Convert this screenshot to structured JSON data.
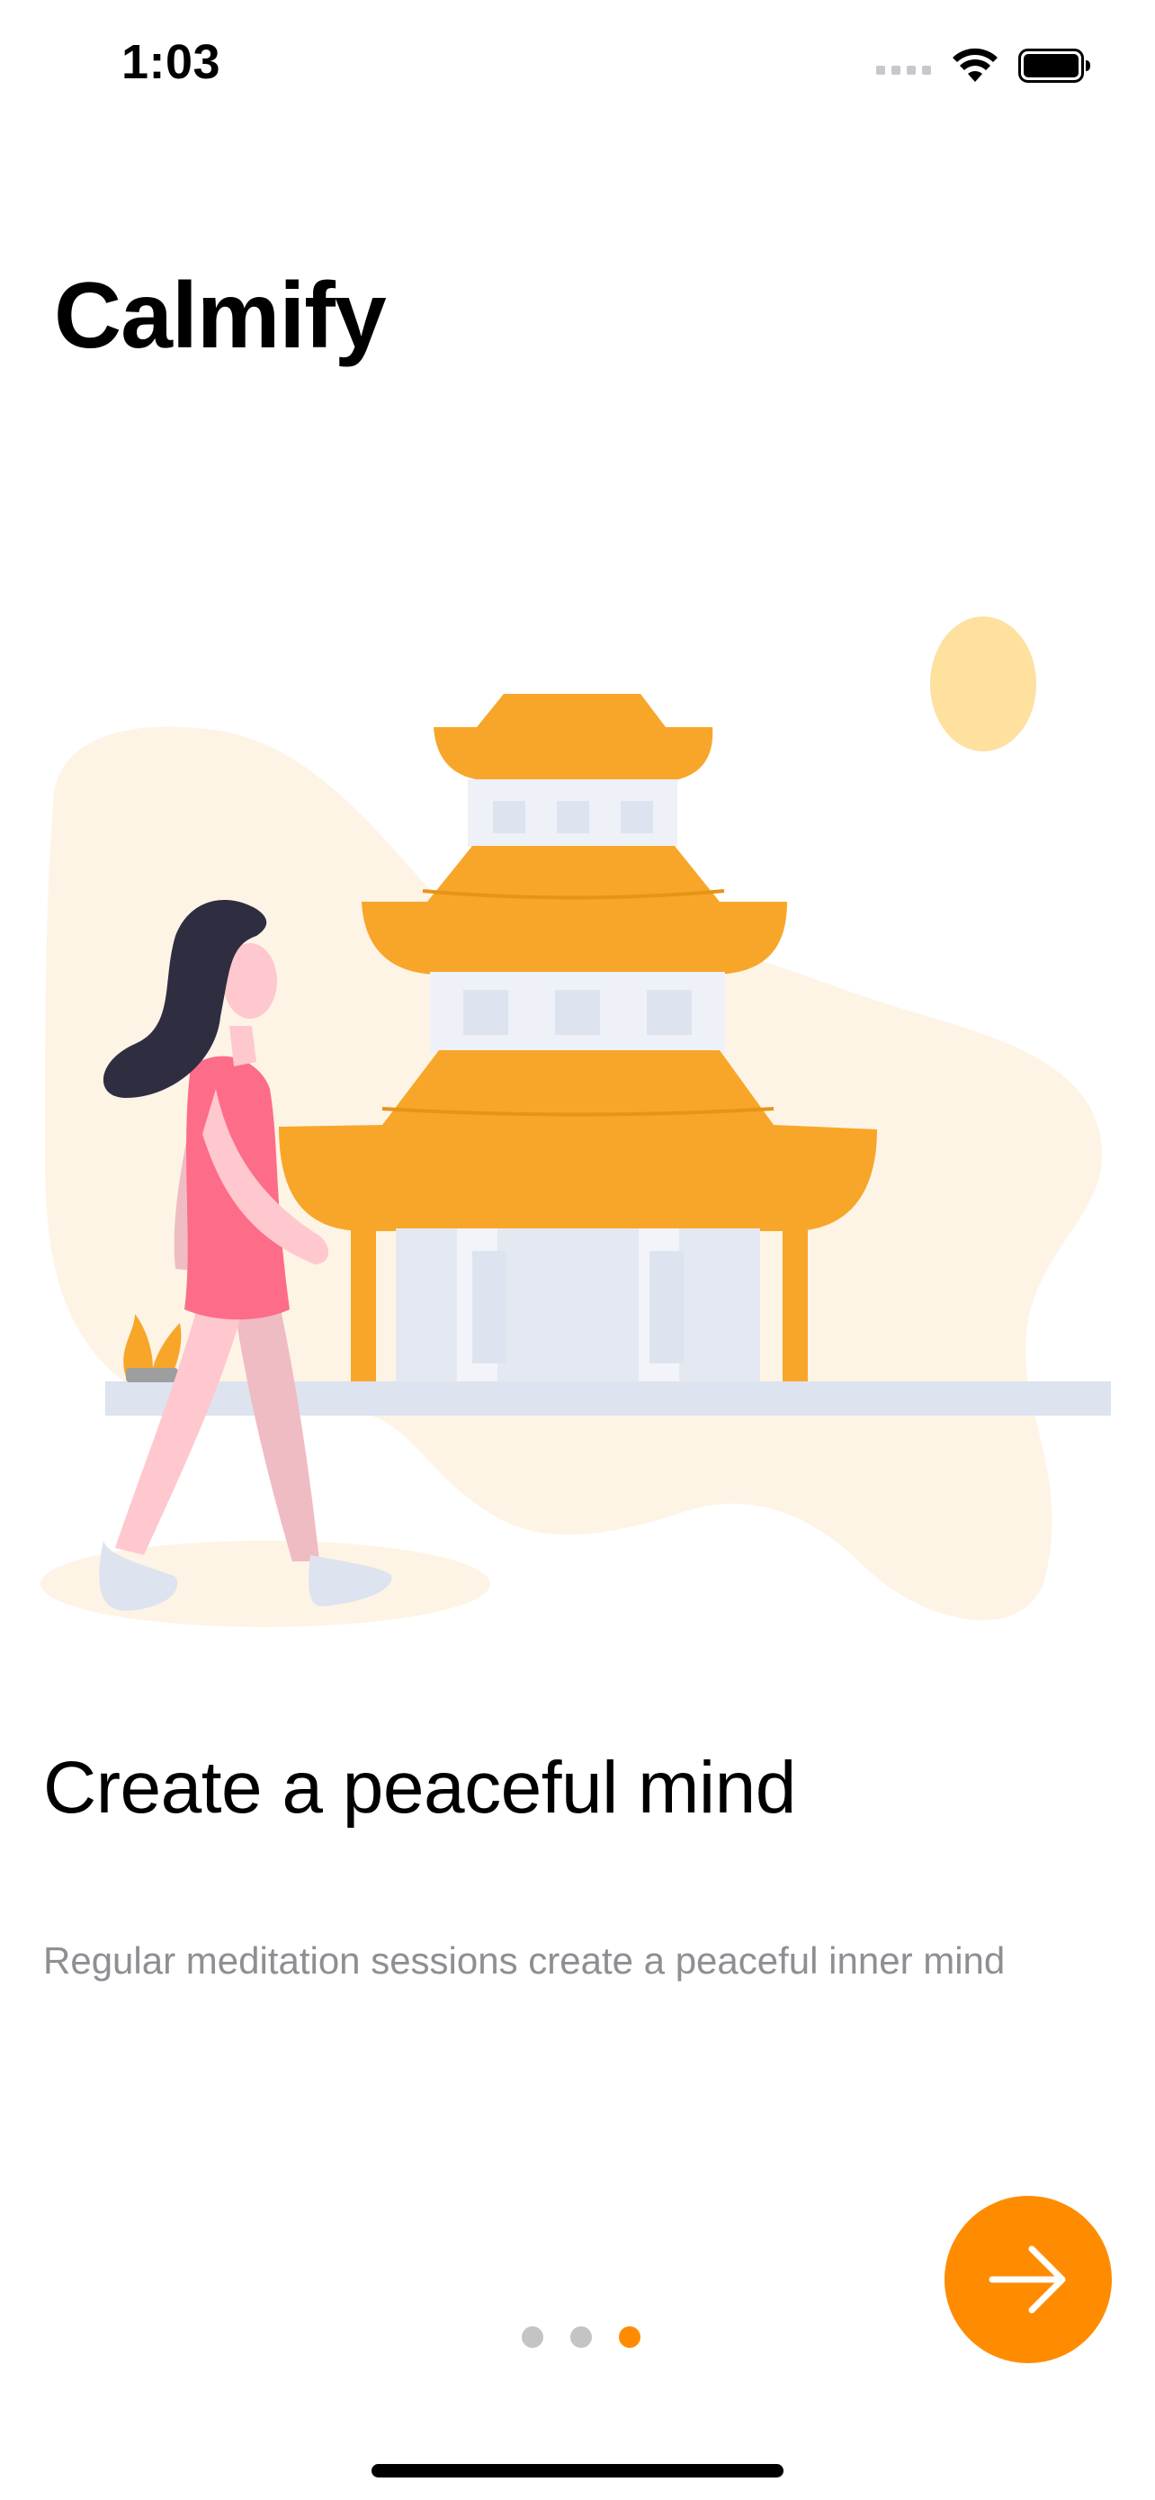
{
  "status_bar": {
    "time": "1:03",
    "icons": [
      "cellular-signal-icon",
      "wifi-icon",
      "battery-icon"
    ]
  },
  "app": {
    "title": "Calmify"
  },
  "onboarding": {
    "headline": "Create a peaceful mind",
    "subtitle": "Regular meditation sessions create a peaceful inner mind",
    "page_count": 3,
    "current_page": 3
  },
  "next_button": {
    "icon": "arrow-right-icon"
  },
  "colors": {
    "accent": "#ff8c00",
    "temple": "#f8a629",
    "dot_inactive": "#c4c4c6",
    "subtitle": "#8e8e93"
  }
}
